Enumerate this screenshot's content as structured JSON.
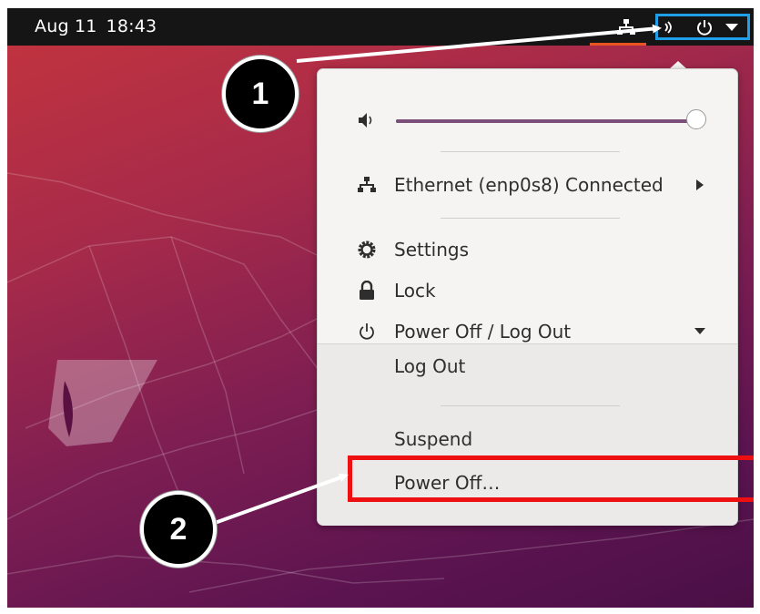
{
  "topbar": {
    "date": "Aug 11",
    "time": "18:43",
    "icons": [
      "network-icon",
      "volume-icon",
      "power-icon",
      "dropdown-arrow-icon"
    ]
  },
  "menu": {
    "volume": {
      "icon": "speaker-icon",
      "level_percent": 100
    },
    "ethernet": {
      "icon": "network-icon",
      "label": "Ethernet (enp0s8) Connected"
    },
    "settings": {
      "icon": "gear-icon",
      "label": "Settings"
    },
    "lock": {
      "icon": "lock-icon",
      "label": "Lock"
    },
    "power": {
      "icon": "power-icon",
      "label": "Power Off / Log Out",
      "expanded": true
    },
    "submenu": {
      "log_out": "Log Out",
      "suspend": "Suspend",
      "power_off": "Power Off…"
    }
  },
  "annotations": {
    "step1": "1",
    "step2": "2",
    "highlight_color": "#ee1010",
    "tray_box_color": "#1f9fe7"
  }
}
